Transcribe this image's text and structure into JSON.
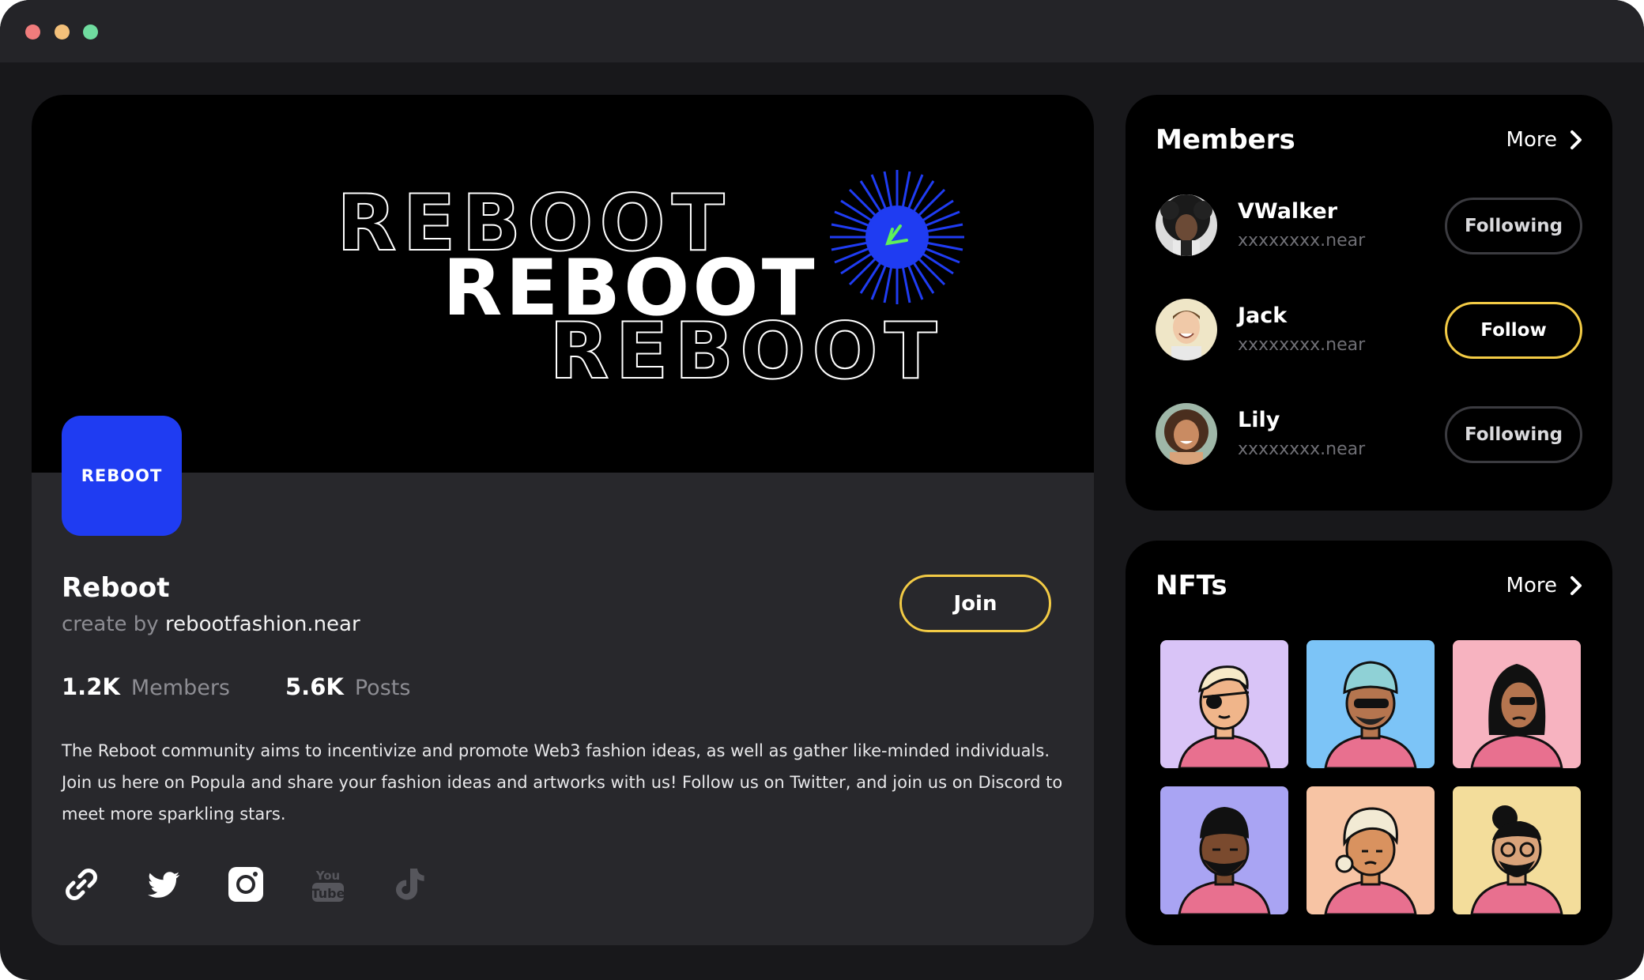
{
  "window": {
    "controls": [
      "close",
      "minimize",
      "maximize"
    ]
  },
  "banner": {
    "words": [
      "REBOOT",
      "REBOOT",
      "REBOOT"
    ],
    "accent_color": "#1f3cf2",
    "spark_color": "#5ff05a"
  },
  "community": {
    "logo_text": "REBOOT",
    "name": "Reboot",
    "created_by_label": "create by",
    "owner": "rebootfashion.near",
    "join_label": "Join",
    "stats": [
      {
        "value": "1.2K",
        "label": "Members"
      },
      {
        "value": "5.6K",
        "label": "Posts"
      }
    ],
    "description": "The Reboot community aims to incentivize and promote Web3 fashion ideas, as well as gather like-minded individuals. Join us here on Popula and share your fashion ideas and artworks with us! Follow us on Twitter, and join us on Discord to meet more sparkling stars.",
    "socials": [
      {
        "icon": "link-icon",
        "active": true
      },
      {
        "icon": "twitter-icon",
        "active": true
      },
      {
        "icon": "instagram-icon",
        "active": true
      },
      {
        "icon": "youtube-icon",
        "active": false
      },
      {
        "icon": "tiktok-icon",
        "active": false
      }
    ]
  },
  "members": {
    "title": "Members",
    "more_label": "More",
    "items": [
      {
        "name": "VWalker",
        "handle": "xxxxxxxx.near",
        "button": "Following"
      },
      {
        "name": "Jack",
        "handle": "xxxxxxxx.near",
        "button": "Follow"
      },
      {
        "name": "Lily",
        "handle": "xxxxxxxx.near",
        "button": "Following"
      }
    ]
  },
  "nfts": {
    "title": "NFTs",
    "more_label": "More",
    "items": [
      {
        "bg": "#d9c4f7"
      },
      {
        "bg": "#7cc4f7"
      },
      {
        "bg": "#f7b3c0"
      },
      {
        "bg": "#a9a4f3"
      },
      {
        "bg": "#f7c4a4"
      },
      {
        "bg": "#f3dd9b"
      }
    ]
  },
  "colors": {
    "accent_yellow": "#f3cb45",
    "brand_blue": "#1f3cf2",
    "shirt_pink": "#e8708f"
  }
}
